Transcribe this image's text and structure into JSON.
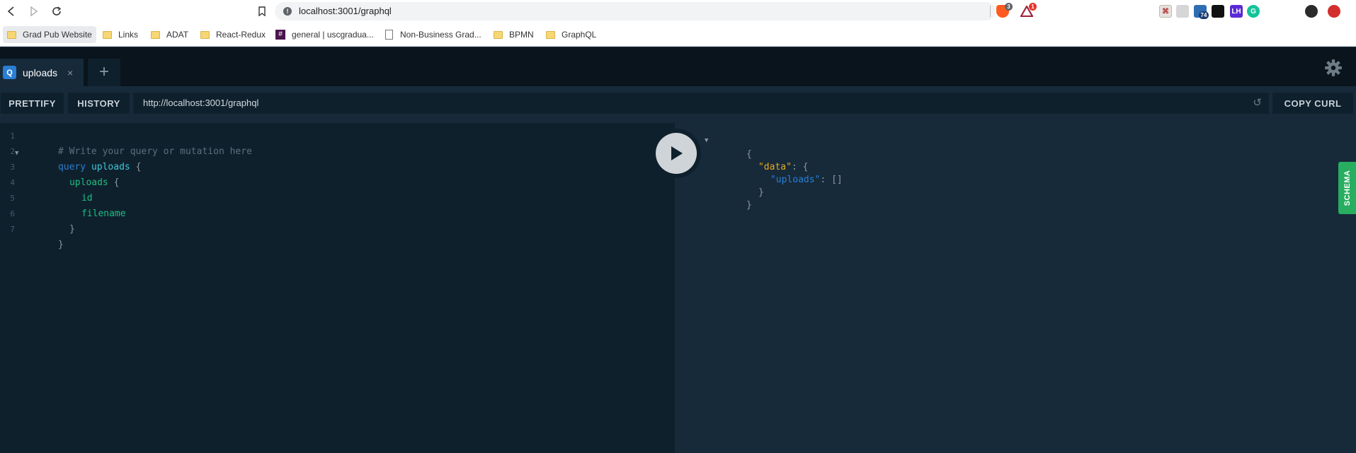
{
  "browser": {
    "url": "localhost:3001/graphql",
    "extensions": [
      {
        "name": "brave-shield",
        "badge": "3"
      },
      {
        "name": "brave-rewards",
        "badge": "1"
      },
      {
        "name": "pdf-extension",
        "badge": ""
      },
      {
        "name": "copy-extension",
        "badge": ""
      },
      {
        "name": "cloud-extension",
        "badge": "74"
      },
      {
        "name": "copy-window-extension",
        "badge": ""
      },
      {
        "name": "lighthouse",
        "label": "LH"
      },
      {
        "name": "grammarly",
        "label": "G"
      },
      {
        "name": "profile",
        "badge": ""
      },
      {
        "name": "ublock",
        "badge": ""
      }
    ],
    "bookmarks": [
      {
        "label": "Grad Pub Website",
        "icon": "folder"
      },
      {
        "label": "Links",
        "icon": "folder"
      },
      {
        "label": "ADAT",
        "icon": "folder"
      },
      {
        "label": "React-Redux",
        "icon": "folder"
      },
      {
        "label": "general | uscgradua...",
        "icon": "slack",
        "icon_text": "#"
      },
      {
        "label": "Non-Business Grad...",
        "icon": "document"
      },
      {
        "label": "BPMN",
        "icon": "folder"
      },
      {
        "label": "GraphQL",
        "icon": "folder"
      }
    ]
  },
  "playground": {
    "tab": {
      "icon_letter": "Q",
      "title": "uploads",
      "close": "×"
    },
    "new_tab": "+",
    "toolbar": {
      "prettify": "PRETTIFY",
      "history": "HISTORY",
      "endpoint": "http://localhost:3001/graphql",
      "copy_curl": "COPY CURL"
    },
    "query_lines": [
      "1",
      "2",
      "3",
      "4",
      "5",
      "6",
      "7"
    ],
    "query": {
      "comment": "# Write your query or mutation here",
      "keyword": "query",
      "operation": "uploads",
      "open_brace": "{",
      "field_root": "uploads",
      "field_id": "id",
      "field_filename": "filename",
      "close_inner": "}",
      "close_outer": "}"
    },
    "result": {
      "open": "{",
      "data_key": "\"data\"",
      "data_open": ": {",
      "uploads_key": "\"uploads\"",
      "uploads_value": ": []",
      "data_close": "}",
      "close": "}"
    },
    "schema_tab": "SCHEMA"
  },
  "colors": {
    "background": "#172a3a",
    "editor": "#0f202d",
    "keyword": "#2a7ed3",
    "field": "#1cbe81",
    "json_key": "#e8a91d",
    "schema": "#27ae60"
  }
}
